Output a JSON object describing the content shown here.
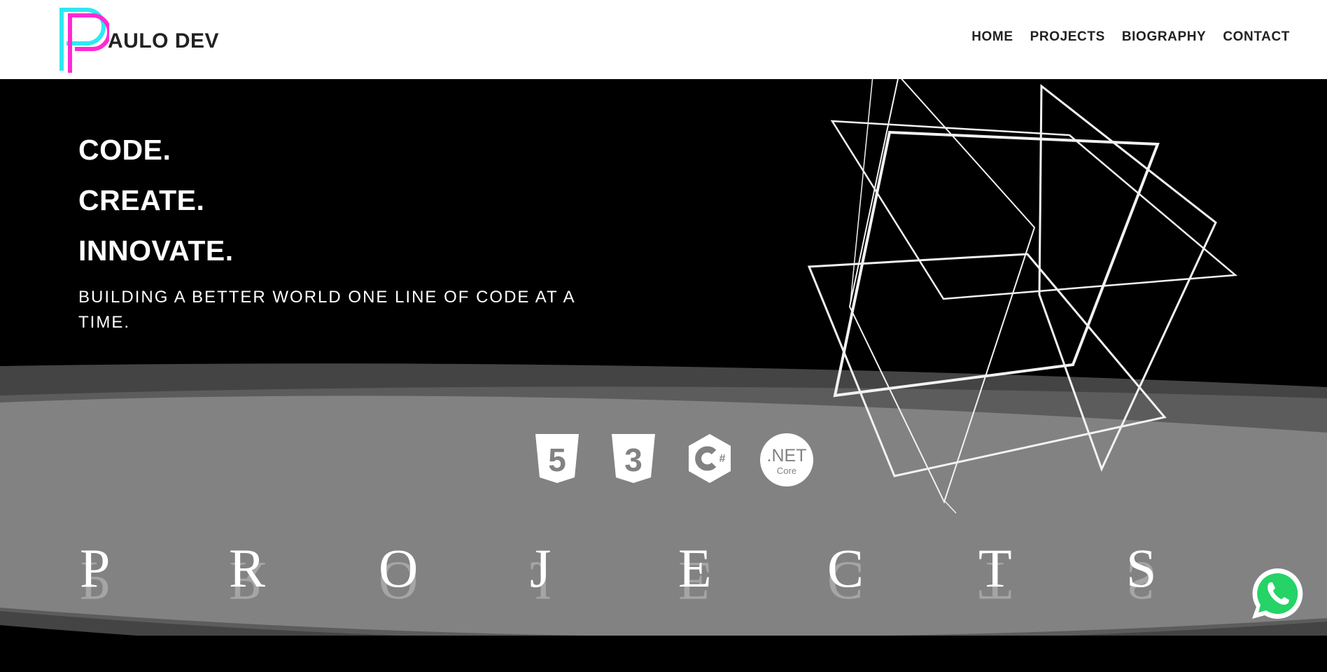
{
  "brand": {
    "logo_letter": "P",
    "name": "AULO DEV",
    "logo_colors": [
      "#2ee8f0",
      "#ff2ad4"
    ]
  },
  "nav": {
    "items": [
      "HOME",
      "PROJECTS",
      "BIOGRAPHY",
      "CONTACT"
    ]
  },
  "hero": {
    "lines": [
      "CODE.",
      "CREATE.",
      "INNOVATE."
    ],
    "tagline": "BUILDING A BETTER WORLD ONE LINE OF CODE AT A TIME."
  },
  "tech_icons": [
    {
      "icon": "html5-icon",
      "label": "5"
    },
    {
      "icon": "css3-icon",
      "label": "3"
    },
    {
      "icon": "csharp-icon",
      "label": "#"
    },
    {
      "icon": "dotnet-core-icon",
      "label": ".NET",
      "sublabel": "Core"
    }
  ],
  "projects_heading": {
    "letters": [
      "P",
      "R",
      "O",
      "J",
      "E",
      "C",
      "T",
      "S"
    ]
  },
  "whatsapp": {
    "icon": "whatsapp-icon",
    "color": "#25d366"
  },
  "colors": {
    "band_dark": "#444444",
    "band_mid": "#5c5c5c",
    "band_light": "#828282"
  }
}
